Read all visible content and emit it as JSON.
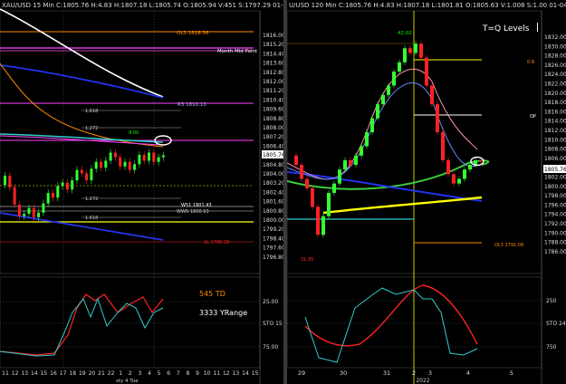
{
  "left": {
    "header": "XAU/USD 15 Min C:1805.76 H:4.83 H:1807.18 L:1805.74 O:1805.94 V:451 S:1797.29 01-04-22 6:16",
    "price_axis": [
      "1816.00",
      "1815.20",
      "1814.40",
      "1813.60",
      "1812.80",
      "1812.00",
      "1811.20",
      "1810.40",
      "1809.60",
      "1808.80",
      "1808.00",
      "1807.20",
      "1806.40",
      "1805.60",
      "1804.80",
      "1804.00",
      "1803.20",
      "1802.40",
      "1801.60",
      "1800.80",
      "1800.00",
      "1799.20",
      "1798.40",
      "1797.60",
      "1796.80"
    ],
    "current_price": "1805.76",
    "levels": {
      "ol3": "OL3 1816.36",
      "month_mid": "Month Mid Point",
      "r3": "R3 1810.10",
      "f618": "1.618",
      "f272": "1.272",
      "f1": "1",
      "f272b": "1.272",
      "f618b": "1.618",
      "w51": "W51 1801.43",
      "wwr": "WWR 1800.93",
      "l1": "1L 1799.29",
      "time_label": "9:00"
    },
    "indicator": {
      "labels": [
        "25.00",
        "STO 15",
        "75.00"
      ],
      "td": "545 TD",
      "yrange": "3333 YRange"
    },
    "time_axis": [
      "11",
      "12",
      "13",
      "14",
      "15",
      "16",
      "17",
      "18",
      "19",
      "20",
      "21",
      "22",
      "1",
      "2",
      "3",
      "4",
      "5",
      "6",
      "7",
      "8",
      "9",
      "10",
      "11",
      "12",
      "13",
      "14",
      "15"
    ],
    "date_label": "sty 4 Tue"
  },
  "right": {
    "header": "U/USD 120 Min C:1805.76 H:4.83 H:1807.18 L:1801.81 O:1805.63 V:1.008 S:1.00 01-04-22 1:36:16",
    "title": "T=Q Levels",
    "price_axis": [
      "1832.00",
      "1830.00",
      "1828.00",
      "1826.00",
      "1824.00",
      "1822.00",
      "1820.00",
      "1818.00",
      "1816.00",
      "1814.00",
      "1812.00",
      "1810.00",
      "1808.00",
      "1806.00",
      "1804.00",
      "1802.00",
      "1800.00",
      "1798.00",
      "1796.00",
      "1794.00",
      "1792.00",
      "1790.00",
      "1788.00",
      "1786.00"
    ],
    "current_price": "1805.76",
    "levels": {
      "top": "42.02",
      "r1": "0 R",
      "op": "OP",
      "ol3": "OL3 1791.08",
      "low": "31.95"
    },
    "indicator": {
      "labels": [
        "250",
        "STO 24",
        "750"
      ]
    },
    "time_axis": [
      "29",
      "30",
      "31",
      "2",
      "3",
      "4",
      "5"
    ],
    "year_label": "2022"
  },
  "colors": {
    "up": "#33ff33",
    "down": "#ff2222",
    "magenta": "#ff44ff",
    "blue": "#2233ee",
    "orange": "#ff8800",
    "yellow": "#ffff00",
    "cyan": "#33cccc"
  }
}
